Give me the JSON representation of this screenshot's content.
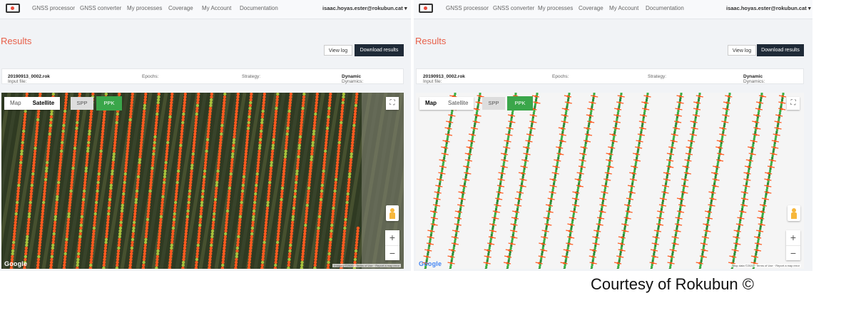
{
  "nav": {
    "items": [
      "GNSS processor",
      "GNSS converter",
      "My processes",
      "Coverage",
      "My Account",
      "Documentation"
    ],
    "user": "isaac.hoyas.ester@rokubun.cat"
  },
  "page": {
    "title": "Results",
    "view_log": "View log",
    "download": "Download results"
  },
  "info": {
    "input_file_label": "Input file:",
    "input_file": "20190913_0002.rok",
    "epochs_label": "Epochs:",
    "strategy_label": "Strategy:",
    "dynamics_label": "Dynamics:",
    "dynamics": "Dynamic"
  },
  "map": {
    "map_label": "Map",
    "satellite_label": "Satellite",
    "spp_label": "SPP",
    "ppk_label": "PPK",
    "fullscreen_glyph": "⛶",
    "zoom_in": "+",
    "zoom_out": "−",
    "google": "Google",
    "left_attribution": "Imagery ©2020 · Terms of Use · Report a map error",
    "right_attribution": "Map data ©2020 · Terms of Use · Report a map error",
    "left_selected": "satellite",
    "right_selected": "map",
    "icons": [
      "fullscreen-icon",
      "pegman-icon"
    ]
  },
  "colors": {
    "accent": "#e8604a",
    "dark_button": "#1f2a37",
    "ppk_green": "#3aa64a",
    "fix_green": "#3cb043",
    "float_orange": "#ff5a1f"
  },
  "courtesy": "Courtesy of Rokubun ©"
}
